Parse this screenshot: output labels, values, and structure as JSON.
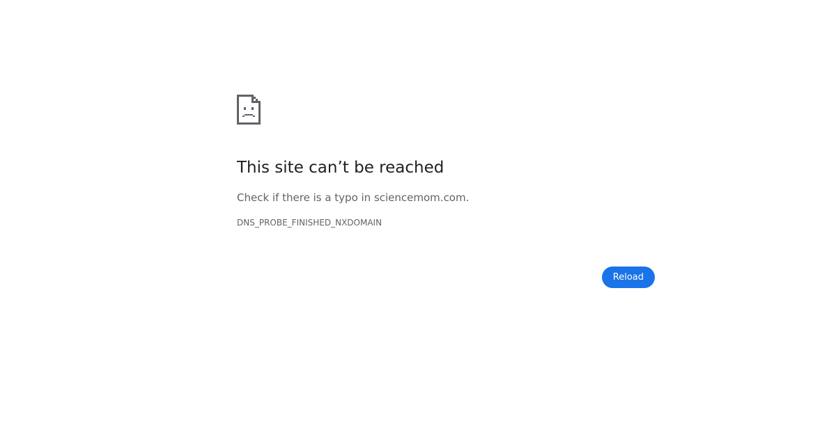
{
  "error_page": {
    "icon": "sad-document-icon",
    "title": "This site can’t be reached",
    "summary": "Check if there is a typo in sciencemom.com.",
    "error_code": "DNS_PROBE_FINISHED_NXDOMAIN",
    "reload_label": "Reload"
  },
  "colors": {
    "background": "#ffffff",
    "title": "#202124",
    "secondary_text": "#5f6368",
    "icon": "#5f6368",
    "button_bg": "#1a73e8",
    "button_text": "#ffffff"
  }
}
